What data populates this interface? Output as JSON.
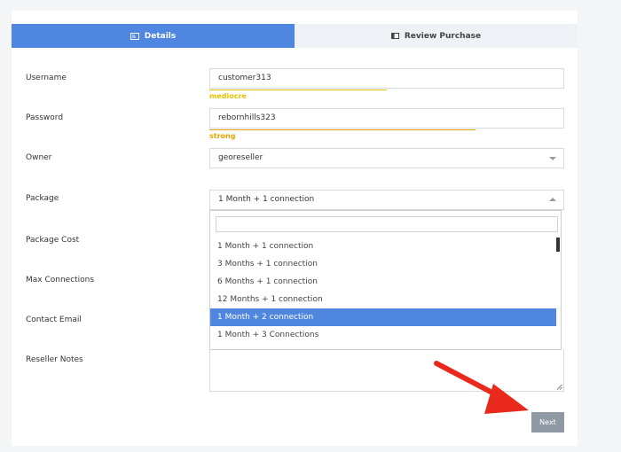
{
  "tabs": [
    {
      "label": "Details",
      "icon": "id-card-icon",
      "active": true
    },
    {
      "label": "Review Purchase",
      "icon": "card-icon",
      "active": false
    }
  ],
  "form": {
    "username": {
      "label": "Username",
      "value": "customer313",
      "strength": "mediocre",
      "strength_color": "#e6c200",
      "strength_fraction": 0.5
    },
    "password": {
      "label": "Password",
      "value": "rebornhills323",
      "strength": "strong",
      "strength_color": "#e0a300",
      "strength_fraction": 0.75
    },
    "owner": {
      "label": "Owner",
      "value": "georeseller"
    },
    "package": {
      "label": "Package",
      "value": "1 Month + 1 connection"
    },
    "package_cost": {
      "label": "Package Cost"
    },
    "max_connections": {
      "label": "Max Connections"
    },
    "contact_email": {
      "label": "Contact Email"
    },
    "reseller_notes": {
      "label": "Reseller Notes"
    }
  },
  "dropdown": {
    "search_value": "",
    "options": [
      "1 Month + 1 connection",
      "3 Months + 1 connection",
      "6 Months + 1 connection",
      "12 Months + 1 connection",
      "1 Month + 2 connection",
      "1 Month + 3 Connections"
    ],
    "selected_index": 4
  },
  "buttons": {
    "next_label": "Next"
  },
  "colors": {
    "accent": "#4f86e0",
    "arrow": "#e8291c",
    "button": "#8e99a4"
  }
}
